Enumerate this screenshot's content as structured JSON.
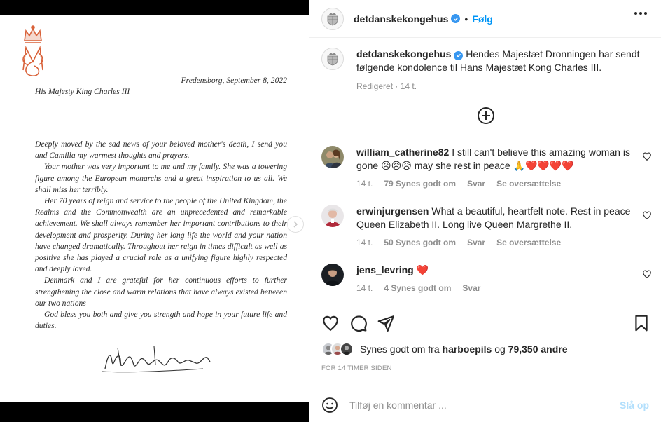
{
  "letter": {
    "date": "Fredensborg, September 8, 2022",
    "addressee": "His Majesty King Charles III",
    "paragraphs": [
      "Deeply moved by the sad news of your beloved mother's death, I send you and Camilla my warmest thoughts and prayers.",
      "Your mother was very important to me and my family. She was a towering figure among the European monarchs and a great inspiration to us all. We shall miss her terribly.",
      "Her 70 years of reign and service to the people of the United Kingdom, the Realms and the Commonwealth are an unprecedented and remarkable achievement. We shall always remember her important contributions to their development and prosperity. During her long life the world and your nation have changed dramatically. Throughout her reign in times difficult as well as positive she has played a crucial role as a unifying figure highly respected and deeply loved.",
      "Denmark and I are grateful for her continuous efforts to further strengthening the close and warm relations that have always existed between our two nations",
      "God bless you both and give you strength and hope in your future life and duties."
    ]
  },
  "header": {
    "username": "detdanskekongehus",
    "separator": "•",
    "follow_label": "Følg"
  },
  "caption": {
    "username": "detdanskekongehus",
    "text": "Hendes Majestæt Dronningen har sendt følgende kondolence til Hans Majestæt Kong Charles III.",
    "meta": "Redigeret · 14 t."
  },
  "comments": [
    {
      "username": "william_catherine82",
      "text": "I still can't believe this amazing woman is gone 😥😥😥 may she rest in peace 🙏❤️❤️❤️❤️",
      "time": "14 t.",
      "likes": "79 Synes godt om",
      "reply": "Svar",
      "translate": "Se oversættelse"
    },
    {
      "username": "erwinjurgensen",
      "text": "What a beautiful, heartfelt note. Rest in peace Queen Elizabeth II. Long live Queen Margrethe II.",
      "time": "14 t.",
      "likes": "50 Synes godt om",
      "reply": "Svar",
      "translate": "Se oversættelse"
    },
    {
      "username": "jens_levring",
      "text": "❤️",
      "time": "14 t.",
      "likes": "4 Synes godt om",
      "reply": "Svar"
    }
  ],
  "likes": {
    "prefix": "Synes godt om fra",
    "user": "harboepils",
    "connector": "og",
    "others": "79,350 andre"
  },
  "time_ago": "FOR 14 TIMER SIDEN",
  "add_comment": {
    "placeholder": "Tilføj en kommentar ...",
    "post_label": "Slå op"
  },
  "colors": {
    "accent": "#0095f6",
    "post_disabled": "#b2dffc",
    "verified": "#3897f0",
    "monogram": "#d9623a",
    "heart": "#e0245e"
  }
}
